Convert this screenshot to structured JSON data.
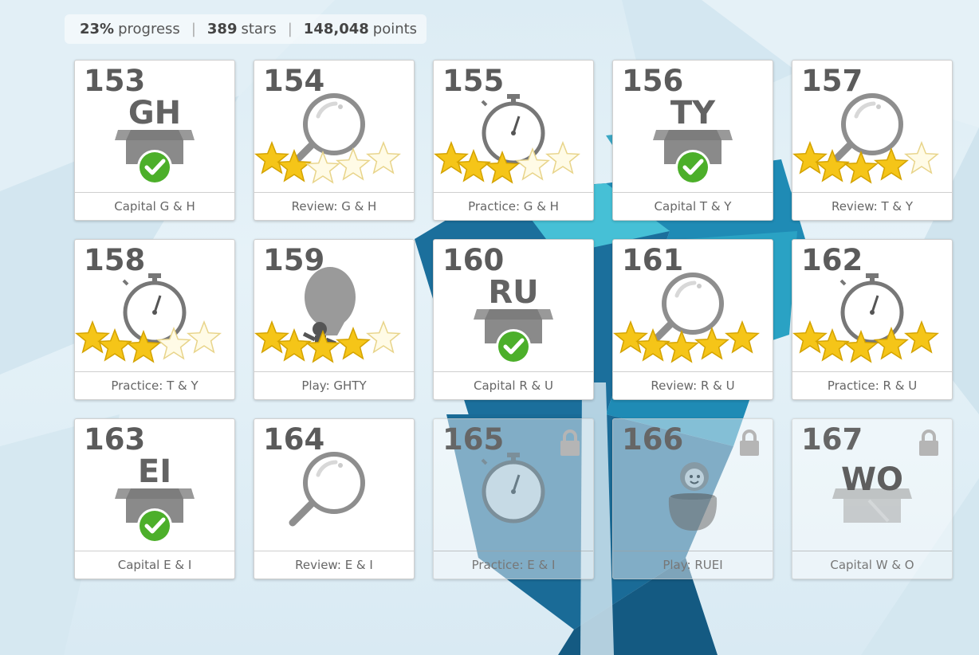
{
  "stats": {
    "progress_value": "23%",
    "progress_label": "progress",
    "stars_value": "389",
    "stars_label": "stars",
    "points_value": "148,048",
    "points_label": "points"
  },
  "colors": {
    "tile_number": "#5b5b5b",
    "star_gold": "#f5c518",
    "check_green": "#4caf2a",
    "icon_gray": "#8e8e8e"
  },
  "tiles": [
    {
      "number": "153",
      "title": "Capital G & H",
      "kind": "capital",
      "letters": "GH",
      "completed": true,
      "locked": false
    },
    {
      "number": "154",
      "title": "Review: G & H",
      "kind": "review",
      "stars": 2,
      "locked": false
    },
    {
      "number": "155",
      "title": "Practice: G & H",
      "kind": "practice",
      "stars": 3,
      "locked": false
    },
    {
      "number": "156",
      "title": "Capital T & Y",
      "kind": "capital",
      "letters": "TY",
      "completed": true,
      "locked": false
    },
    {
      "number": "157",
      "title": "Review: T & Y",
      "kind": "review",
      "stars": 4,
      "locked": false
    },
    {
      "number": "158",
      "title": "Practice: T & Y",
      "kind": "practice",
      "stars": 3,
      "locked": false
    },
    {
      "number": "159",
      "title": "Play: GHTY",
      "kind": "play-balloon",
      "stars": 4,
      "locked": false
    },
    {
      "number": "160",
      "title": "Capital R & U",
      "kind": "capital",
      "letters": "RU",
      "completed": true,
      "locked": false
    },
    {
      "number": "161",
      "title": "Review: R & U",
      "kind": "review",
      "stars": 5,
      "locked": false
    },
    {
      "number": "162",
      "title": "Practice: R & U",
      "kind": "practice",
      "stars": 5,
      "locked": false
    },
    {
      "number": "163",
      "title": "Capital E & I",
      "kind": "capital",
      "letters": "EI",
      "completed": true,
      "locked": false
    },
    {
      "number": "164",
      "title": "Review: E & I",
      "kind": "review",
      "stars": 0,
      "locked": false
    },
    {
      "number": "165",
      "title": "Practice: E & I",
      "kind": "practice",
      "stars": 0,
      "locked": true
    },
    {
      "number": "166",
      "title": "Play: RUEI",
      "kind": "play-pot",
      "stars": 0,
      "locked": true
    },
    {
      "number": "167",
      "title": "Capital W & O",
      "kind": "capital",
      "letters": "WO",
      "completed": false,
      "locked": true
    }
  ]
}
